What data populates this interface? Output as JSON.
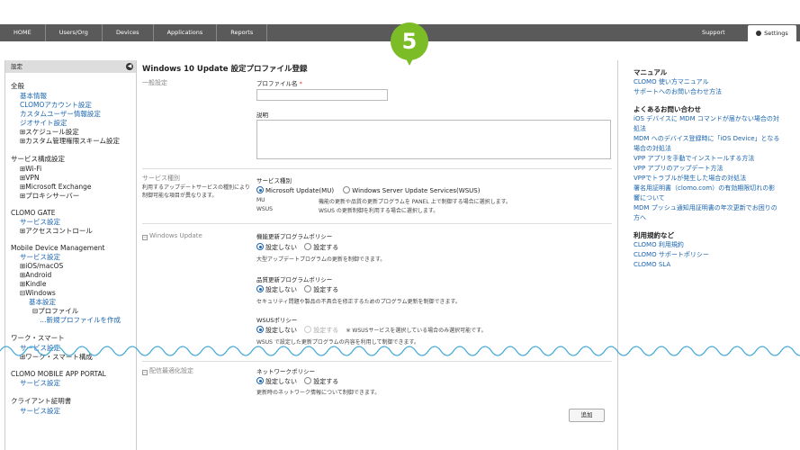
{
  "nav": {
    "items": [
      "HOME",
      "Users/Org",
      "Devices",
      "Applications",
      "Reports"
    ],
    "support": "Support",
    "settings": "Settings"
  },
  "step": "5",
  "sidebar": {
    "header": "設定",
    "sections": [
      {
        "title": "全般",
        "items": [
          {
            "text": "基本情報",
            "type": "l"
          },
          {
            "text": "CLOMOアカウント設定",
            "type": "l"
          },
          {
            "text": "カスタムユーザー情報設定",
            "type": "l"
          },
          {
            "text": "ジオサイト設定",
            "type": "l"
          },
          {
            "text": "⊞スケジュール設定",
            "type": "e"
          },
          {
            "text": "⊞カスタム管理権限スキーム設定",
            "type": "e"
          }
        ]
      },
      {
        "title": "サービス構成設定",
        "items": [
          {
            "text": "⊞Wi-Fi",
            "type": "e"
          },
          {
            "text": "⊞VPN",
            "type": "e"
          },
          {
            "text": "⊞Microsoft Exchange",
            "type": "e"
          },
          {
            "text": "⊞プロキシサーバー",
            "type": "e"
          }
        ]
      },
      {
        "title": "CLOMO GATE",
        "items": [
          {
            "text": "サービス設定",
            "type": "l"
          },
          {
            "text": "⊞アクセスコントロール",
            "type": "e"
          }
        ]
      },
      {
        "title": "Mobile Device Management",
        "items": [
          {
            "text": "サービス設定",
            "type": "l"
          },
          {
            "text": "⊞iOS/macOS",
            "type": "e"
          },
          {
            "text": "⊞Android",
            "type": "e"
          },
          {
            "text": "⊞Kindle",
            "type": "e"
          },
          {
            "text": "⊟Windows",
            "type": "e"
          },
          {
            "text": "基本設定",
            "type": "l2"
          },
          {
            "text": "⊟プロファイル",
            "type": "e3"
          },
          {
            "text": "…新規プロファイルを作成",
            "type": "l3"
          }
        ]
      },
      {
        "title": "ワーク・スマート",
        "items": [
          {
            "text": "サービス設定",
            "type": "l"
          },
          {
            "text": "⊞ワーク・スマート構成",
            "type": "e"
          }
        ]
      },
      {
        "title": "CLOMO MOBILE APP PORTAL",
        "items": [
          {
            "text": "サービス設定",
            "type": "l"
          }
        ]
      },
      {
        "title": "クライアント証明書",
        "items": [
          {
            "text": "サービス設定",
            "type": "l"
          }
        ]
      }
    ]
  },
  "main": {
    "title": "Windows 10 Update 設定プロファイル登録",
    "general_label": "一般設定",
    "profile_name_label": "プロファイル名",
    "required_mark": "*",
    "description_label": "説明",
    "service_section_label": "サービス種別",
    "service_section_desc": "利用するアップデートサービスの種別により制御可能な項目が異なります。",
    "service_field_label": "サービス種別",
    "service_opt_mu": "Microsoft Update(MU)",
    "service_opt_wsus": "Windows Server Update Services(WSUS)",
    "mu_key": "MU",
    "mu_desc": "機能の更新や品質の更新プログラムを PANEL 上で制御する場合に選択します。",
    "wsus_key": "WSUS",
    "wsus_desc": "WSUS の更新制御を利用する場合に選択します。",
    "wu_section_label": "Windows Update",
    "feature_policy_label": "機能更新プログラムポリシー",
    "opt_not_set": "設定しない",
    "opt_set": "設定する",
    "feature_note": "大型アップデートプログラムの更新を制御できます。",
    "quality_policy_label": "品質更新プログラムポリシー",
    "quality_note": "セキュリティ問題や製品の不具合を修正するためのプログラム更新を制御できます。",
    "wsus_policy_label": "WSUSポリシー",
    "wsus_only_note": "※ WSUSサービスを選択している場合のみ選択可能です。",
    "wsus_policy_note": "WSUS で設定した更新プログラムの内容を利用して制御できます。",
    "delivery_section_label": "配信最適化設定",
    "network_policy_label": "ネットワークポリシー",
    "network_note": "更新時のネットワーク情報について制御できます。",
    "add_button": "追加"
  },
  "right": {
    "manual_title": "マニュアル",
    "manual_links": [
      "CLOMO 使い方マニュアル",
      "サポートへのお問い合わせ方法"
    ],
    "faq_title": "よくあるお問い合わせ",
    "faq_links": [
      "iOS デバイスに MDM コマンドが届かない場合の対",
      "処法",
      "MDM へのデバイス登録時に「iOS Device」となる",
      "場合の対処法",
      "VPP アプリを手動でインストールする方法",
      "VPP アプリのアップデート方法",
      "VPPでトラブルが発生した場合の対処法",
      "署名用証明書（clomo.com）の有効期限切れの影",
      "響について",
      "MDM プッシュ通知用証明書の年次更新でお困りの",
      "方へ"
    ],
    "terms_title": "利用規約など",
    "terms_links": [
      "CLOMO 利用規約",
      "CLOMO サポートポリシー",
      "CLOMO SLA"
    ]
  }
}
